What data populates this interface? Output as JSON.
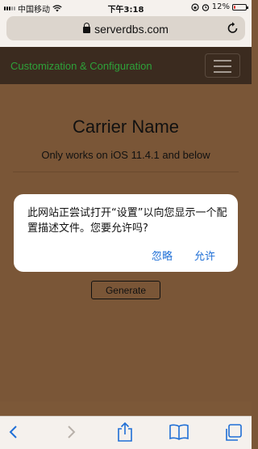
{
  "status_bar": {
    "carrier": "中国移动",
    "time": "下午3:18",
    "battery_percent": "12%",
    "battery_level": 0.12
  },
  "address_bar": {
    "url": "serverdbs.com"
  },
  "navbar": {
    "brand": "Customization & Configuration"
  },
  "main": {
    "title": "Carrier Name",
    "subtitle": "Only works on iOS 11.4.1 and below",
    "generate_label": "Generate"
  },
  "dialog": {
    "message": "此网站正尝试打开“设置”以向您显示一个配置描述文件。您要允许吗?",
    "ignore_label": "忽略",
    "allow_label": "允许"
  },
  "colors": {
    "page_background": "#7a5637",
    "navbar_background": "#3b2b1f",
    "brand_text": "#2ea23a",
    "link_blue": "#1f6fd6"
  },
  "toolbar": {
    "icons": [
      "back-icon",
      "forward-icon",
      "share-icon",
      "bookmarks-icon",
      "tabs-icon"
    ]
  }
}
